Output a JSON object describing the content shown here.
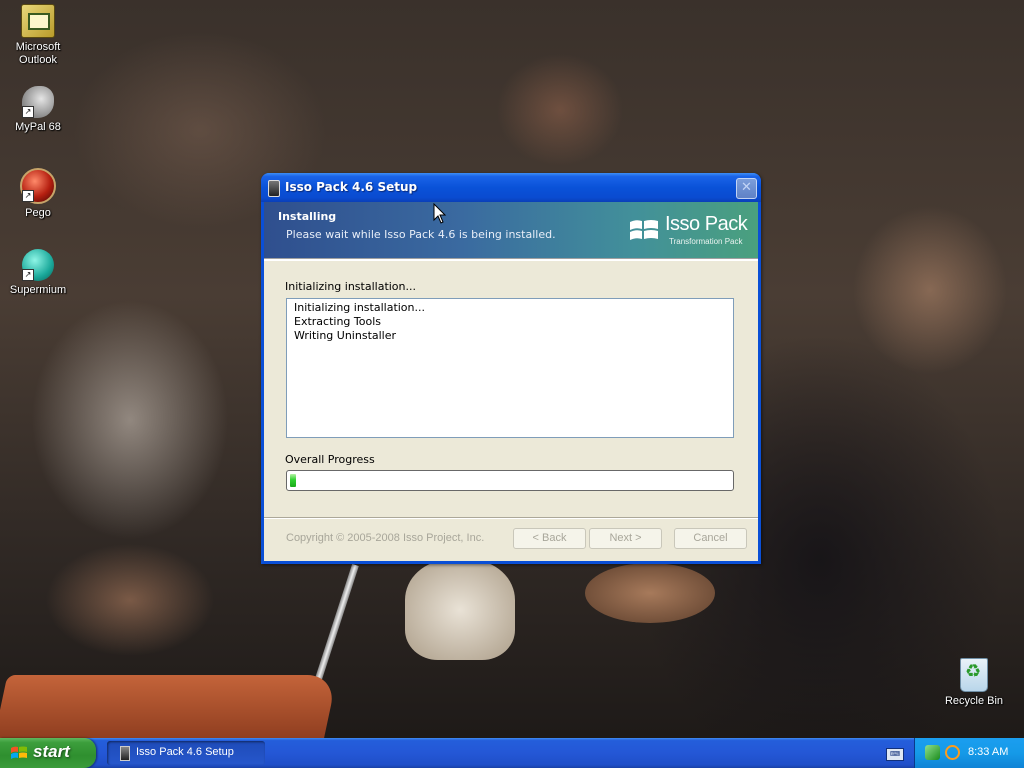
{
  "desktop": {
    "icons": [
      {
        "label": "Microsoft Outlook",
        "icon": "outlook-icon"
      },
      {
        "label": "MyPal 68",
        "icon": "mypal-icon"
      },
      {
        "label": "Pego",
        "icon": "pego-icon"
      },
      {
        "label": "Supermium",
        "icon": "supermium-icon"
      },
      {
        "label": "Recycle Bin",
        "icon": "recycle-bin-icon"
      }
    ],
    "outlook_line1": "Microsoft",
    "outlook_line2": "Outlook"
  },
  "window": {
    "title": "Isso Pack 4.6 Setup",
    "close_glyph": "✕",
    "header": {
      "title": "Installing",
      "subtitle": "Please wait while Isso Pack 4.6 is being installed.",
      "brand_name": "Isso Pack",
      "brand_sub": "Transformation Pack"
    },
    "status": "Initializing installation...",
    "log": [
      "Initializing installation...",
      "Extracting Tools",
      "Writing Uninstaller"
    ],
    "progress_label": "Overall Progress",
    "progress_value": 0.01,
    "copyright": "Copyright © 2005-2008 Isso Project, Inc.",
    "buttons": {
      "back": "< Back",
      "next": "Next >",
      "cancel": "Cancel"
    }
  },
  "taskbar": {
    "start_label": "start",
    "task_label": "Isso Pack 4.6 Setup",
    "clock": "8:33 AM"
  },
  "colors": {
    "titlebar": "#0a52d8",
    "dialog_bg": "#ece9d8",
    "progress_green": "#2fd12f",
    "start_green": "#3c9e3c",
    "tray_blue": "#159ae8"
  }
}
